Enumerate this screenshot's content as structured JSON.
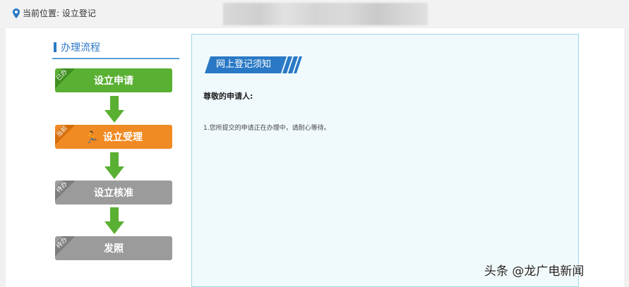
{
  "location": {
    "label": "当前位置: 设立登记",
    "icon": "location-pin-icon"
  },
  "workflow": {
    "title": "办理流程",
    "steps": [
      {
        "tag": "已办",
        "label": "设立申请",
        "status": "done",
        "color": "#5ab033"
      },
      {
        "tag": "当前",
        "label": "设立受理",
        "status": "current",
        "color": "#f08a22"
      },
      {
        "tag": "待办",
        "label": "设立核准",
        "status": "pending",
        "color": "#9b9b9b"
      },
      {
        "tag": "待办",
        "label": "发照",
        "status": "pending",
        "color": "#9b9b9b"
      }
    ],
    "arrow_color": "#5ab033"
  },
  "notice": {
    "banner": "网上登记须知",
    "greeting": "尊敬的申请人:",
    "message": "1.您所提交的申请正在办理中，请耐心等待。"
  },
  "watermark": "头条 @龙广电新闻"
}
